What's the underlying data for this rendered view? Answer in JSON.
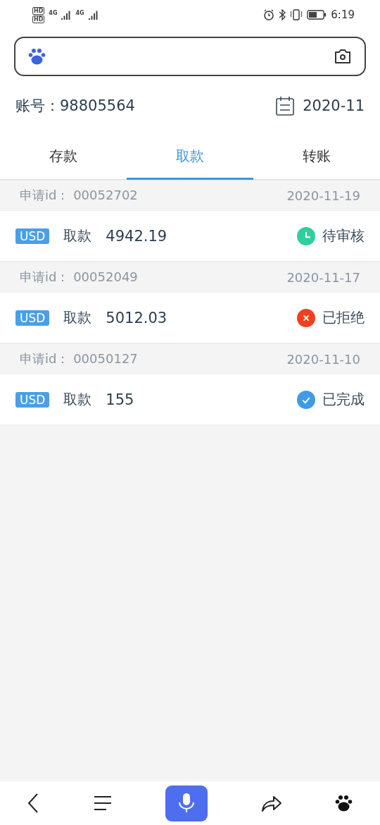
{
  "status_bar": {
    "sims": [
      "HD",
      "HD"
    ],
    "networks": [
      "4G",
      "4G"
    ],
    "time": "6:19"
  },
  "account": {
    "label": "账号：",
    "number": "98805564",
    "month": "2020-11"
  },
  "tabs": [
    {
      "label": "存款",
      "selected": false
    },
    {
      "label": "取款",
      "selected": true
    },
    {
      "label": "转账",
      "selected": false
    }
  ],
  "records": [
    {
      "id_label": "申请id：",
      "id": "00052702",
      "date": "2020-11-19",
      "currency": "USD",
      "type": "取款",
      "amount": "4942.19",
      "status": "待审核",
      "kind": "pending",
      "color": "#2ecf9f"
    },
    {
      "id_label": "申请id：",
      "id": "00052049",
      "date": "2020-11-17",
      "currency": "USD",
      "type": "取款",
      "amount": "5012.03",
      "status": "已拒绝",
      "kind": "rejected",
      "color": "#f2401f"
    },
    {
      "id_label": "申请id：",
      "id": "00050127",
      "date": "2020-11-10",
      "currency": "USD",
      "type": "取款",
      "amount": "155",
      "status": "已完成",
      "kind": "done",
      "color": "#3f9be8"
    }
  ]
}
